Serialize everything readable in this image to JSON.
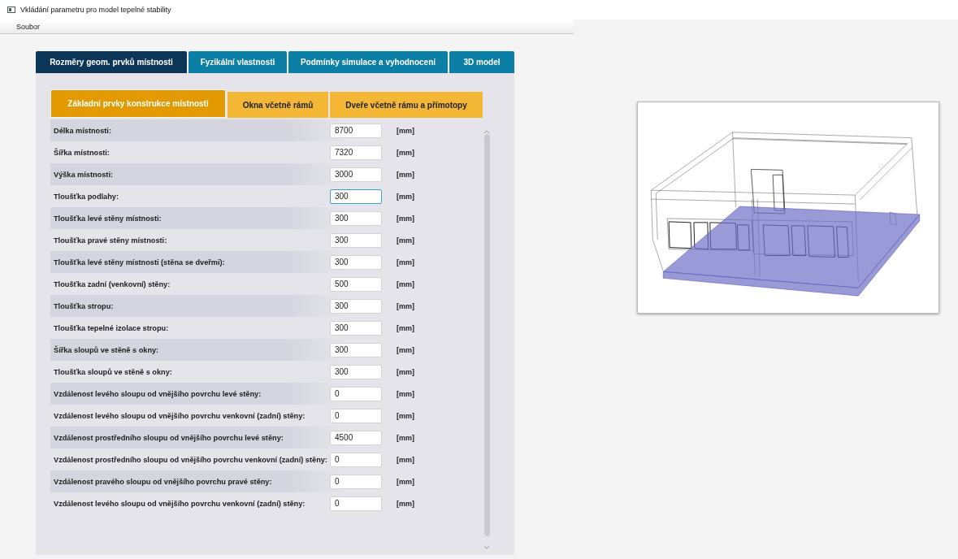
{
  "window": {
    "title": "Vkládání parametru pro model tepelné stability"
  },
  "menu": [
    "Soubor"
  ],
  "tabs": [
    {
      "label": "Rozměry geom. prvků místnosti",
      "selected": true
    },
    {
      "label": "Fyzikální vlastnosti",
      "selected": false
    },
    {
      "label": "Podmínky simulace a vyhodnocení",
      "selected": false
    },
    {
      "label": "3D model",
      "selected": false
    }
  ],
  "subtabs": [
    {
      "label": "Základní prvky konstrukce místnosti",
      "selected": true
    },
    {
      "label": "Okna včetně rámů",
      "selected": false
    },
    {
      "label": "Dveře včetně rámu a přímotopy",
      "selected": false
    }
  ],
  "fields": [
    {
      "label": "Délka místnosti:",
      "value": "8700",
      "unit": "[mm]",
      "focused": false
    },
    {
      "label": "Šířka místnosti:",
      "value": "7320",
      "unit": "[mm]",
      "focused": false
    },
    {
      "label": "Výška místnosti:",
      "value": "3000",
      "unit": "[mm]",
      "focused": false
    },
    {
      "label": "Tloušťka podlahy:",
      "value": "300",
      "unit": "[mm]",
      "focused": true
    },
    {
      "label": "Tloušťka levé stěny místnosti:",
      "value": "300",
      "unit": "[mm]",
      "focused": false
    },
    {
      "label": "Tloušťka pravé stěny místnosti:",
      "value": "300",
      "unit": "[mm]",
      "focused": false
    },
    {
      "label": "Tloušťka levé stěny místnosti (stěna se dveřmi):",
      "value": "300",
      "unit": "[mm]",
      "focused": false
    },
    {
      "label": "Tloušťka zadní (venkovní) stěny:",
      "value": "500",
      "unit": "[mm]",
      "focused": false
    },
    {
      "label": "Tloušťka stropu:",
      "value": "300",
      "unit": "[mm]",
      "focused": false
    },
    {
      "label": "Tloušťka tepelné izolace stropu:",
      "value": "300",
      "unit": "[mm]",
      "focused": false
    },
    {
      "label": "Šířka sloupů ve stěně s okny:",
      "value": "300",
      "unit": "[mm]",
      "focused": false
    },
    {
      "label": "Tloušťka sloupů ve stěně s okny:",
      "value": "300",
      "unit": "[mm]",
      "focused": false
    },
    {
      "label": "Vzdálenost levého sloupu od vnějšího povrchu levé stěny:",
      "value": "0",
      "unit": "[mm]",
      "focused": false
    },
    {
      "label": "Vzdálenost levého sloupu od vnějšího povrchu venkovní (zadní) stěny:",
      "value": "0",
      "unit": "[mm]",
      "focused": false
    },
    {
      "label": "Vzdálenost prostředního sloupu od vnějšího povrchu levé stěny:",
      "value": "4500",
      "unit": "[mm]",
      "focused": false
    },
    {
      "label": "Vzdálenost prostředního sloupu od vnějšího povrchu venkovní (zadní) stěny:",
      "value": "0",
      "unit": "[mm]",
      "focused": false
    },
    {
      "label": "Vzdálenost pravého sloupu od vnějšího povrchu pravé stěny:",
      "value": "0",
      "unit": "[mm]",
      "focused": false
    },
    {
      "label": "Vzdálenost levého sloupu od vnějšího povrchu venkovní (zadní) stěny:",
      "value": "0",
      "unit": "[mm]",
      "focused": false
    }
  ]
}
